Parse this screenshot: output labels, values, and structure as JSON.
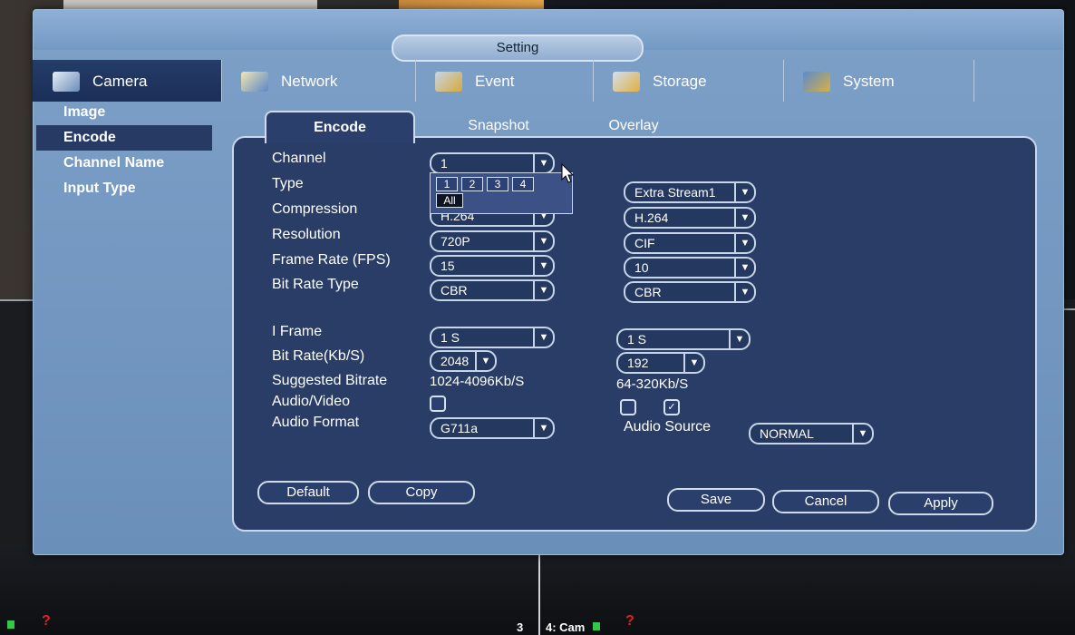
{
  "window": {
    "title": "Setting"
  },
  "topnav": {
    "items": [
      {
        "label": "Camera",
        "icon": "camera-icon"
      },
      {
        "label": "Network",
        "icon": "network-icon"
      },
      {
        "label": "Event",
        "icon": "event-icon"
      },
      {
        "label": "Storage",
        "icon": "storage-icon"
      },
      {
        "label": "System",
        "icon": "system-icon"
      }
    ]
  },
  "sidebar": {
    "items": [
      {
        "label": "Image"
      },
      {
        "label": "Encode"
      },
      {
        "label": "Channel Name"
      },
      {
        "label": "Input Type"
      }
    ]
  },
  "tabs": [
    {
      "label": "Encode"
    },
    {
      "label": "Snapshot"
    },
    {
      "label": "Overlay"
    }
  ],
  "form": {
    "labels": {
      "channel": "Channel",
      "type": "Type",
      "compression": "Compression",
      "resolution": "Resolution",
      "frame_rate": "Frame Rate (FPS)",
      "bit_rate_type": "Bit Rate Type",
      "i_frame": "I Frame",
      "bit_rate": "Bit Rate(Kb/S)",
      "suggested_bitrate": "Suggested Bitrate",
      "audio_video": "Audio/Video",
      "audio_format": "Audio Format",
      "audio_source": "Audio Source"
    },
    "main": {
      "channel": "1",
      "compression": "H.264",
      "resolution": "720P",
      "frame_rate": "15",
      "bit_rate_type": "CBR",
      "i_frame": "1 S",
      "bit_rate": "2048",
      "suggested_bitrate": "1024-4096Kb/S",
      "audio_format": "G711a"
    },
    "extra": {
      "type": "Extra Stream1",
      "compression": "H.264",
      "resolution": "CIF",
      "frame_rate": "10",
      "bit_rate_type": "CBR",
      "i_frame": "1 S",
      "bit_rate": "192",
      "suggested_bitrate": "64-320Kb/S",
      "audio_source": "NORMAL"
    },
    "channel_popup": {
      "options": [
        "1",
        "2",
        "3",
        "4"
      ],
      "all_label": "All"
    }
  },
  "buttons": {
    "default": "Default",
    "copy": "Copy",
    "save": "Save",
    "cancel": "Cancel",
    "apply": "Apply"
  },
  "statusbar": {
    "channel_number": "3",
    "cam_label": "4: Cam"
  },
  "colors": {
    "window": "#7399c3",
    "panel": "#2a3d66",
    "active": "#263a63",
    "status_green": "#34c84a",
    "status_red": "#e02020"
  }
}
